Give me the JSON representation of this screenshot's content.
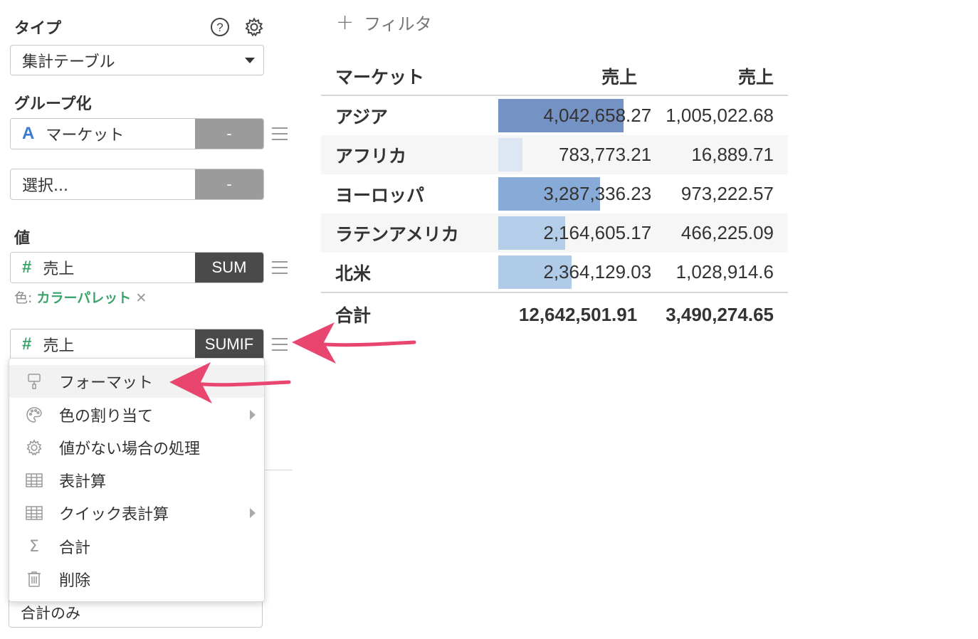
{
  "panel": {
    "type_label": "タイプ",
    "type_select_value": "集計テーブル",
    "group_label": "グループ化",
    "group_field": {
      "type_icon": "A",
      "name": "マーケット",
      "agg": "-"
    },
    "group_select": {
      "placeholder": "選択...",
      "agg": "-"
    },
    "value_label": "値",
    "value_fields": [
      {
        "type_icon": "#",
        "name": "売上",
        "agg": "SUM"
      },
      {
        "type_icon": "#",
        "name": "売上",
        "agg": "SUMIF"
      }
    ],
    "color_note": {
      "prefix": "色:",
      "palette": "カラーパレット",
      "remove": "✕"
    },
    "bottom_select_value": "合計のみ"
  },
  "menu": {
    "items": [
      {
        "label": "フォーマット",
        "icon": "paint-roller-icon",
        "submenu": false
      },
      {
        "label": "色の割り当て",
        "icon": "palette-icon",
        "submenu": true
      },
      {
        "label": "値がない場合の処理",
        "icon": "gear-icon",
        "submenu": false
      },
      {
        "label": "表計算",
        "icon": "table-icon",
        "submenu": false
      },
      {
        "label": "クイック表計算",
        "icon": "table-icon",
        "submenu": true
      },
      {
        "label": "合計",
        "icon": "sigma-icon",
        "submenu": false
      },
      {
        "label": "削除",
        "icon": "trash-icon",
        "submenu": false
      }
    ]
  },
  "filter": {
    "label": "フィルタ",
    "plus": "+"
  },
  "table": {
    "headers": [
      "マーケット",
      "売上",
      "売上"
    ],
    "rows": [
      {
        "market": "アジア",
        "sales1": "4,042,658.27",
        "sales2": "1,005,022.68",
        "bar_fraction": 1.0,
        "bar_color": "#7492c3"
      },
      {
        "market": "アフリカ",
        "sales1": "783,773.21",
        "sales2": "16,889.71",
        "bar_fraction": 0.194,
        "bar_color": "#dde6f3"
      },
      {
        "market": "ヨーロッパ",
        "sales1": "3,287,336.23",
        "sales2": "973,222.57",
        "bar_fraction": 0.813,
        "bar_color": "#88aad6"
      },
      {
        "market": "ラテンアメリカ",
        "sales1": "2,164,605.17",
        "sales2": "466,225.09",
        "bar_fraction": 0.535,
        "bar_color": "#b4cde8"
      },
      {
        "market": "北米",
        "sales1": "2,364,129.03",
        "sales2": "1,028,914.6",
        "bar_fraction": 0.585,
        "bar_color": "#b0cbe7"
      }
    ],
    "total": {
      "label": "合計",
      "sales1": "12,642,501.91",
      "sales2": "3,490,274.65"
    }
  },
  "colors": {
    "accent_red": "#e8466f",
    "palette_green": "#3aa36a"
  }
}
